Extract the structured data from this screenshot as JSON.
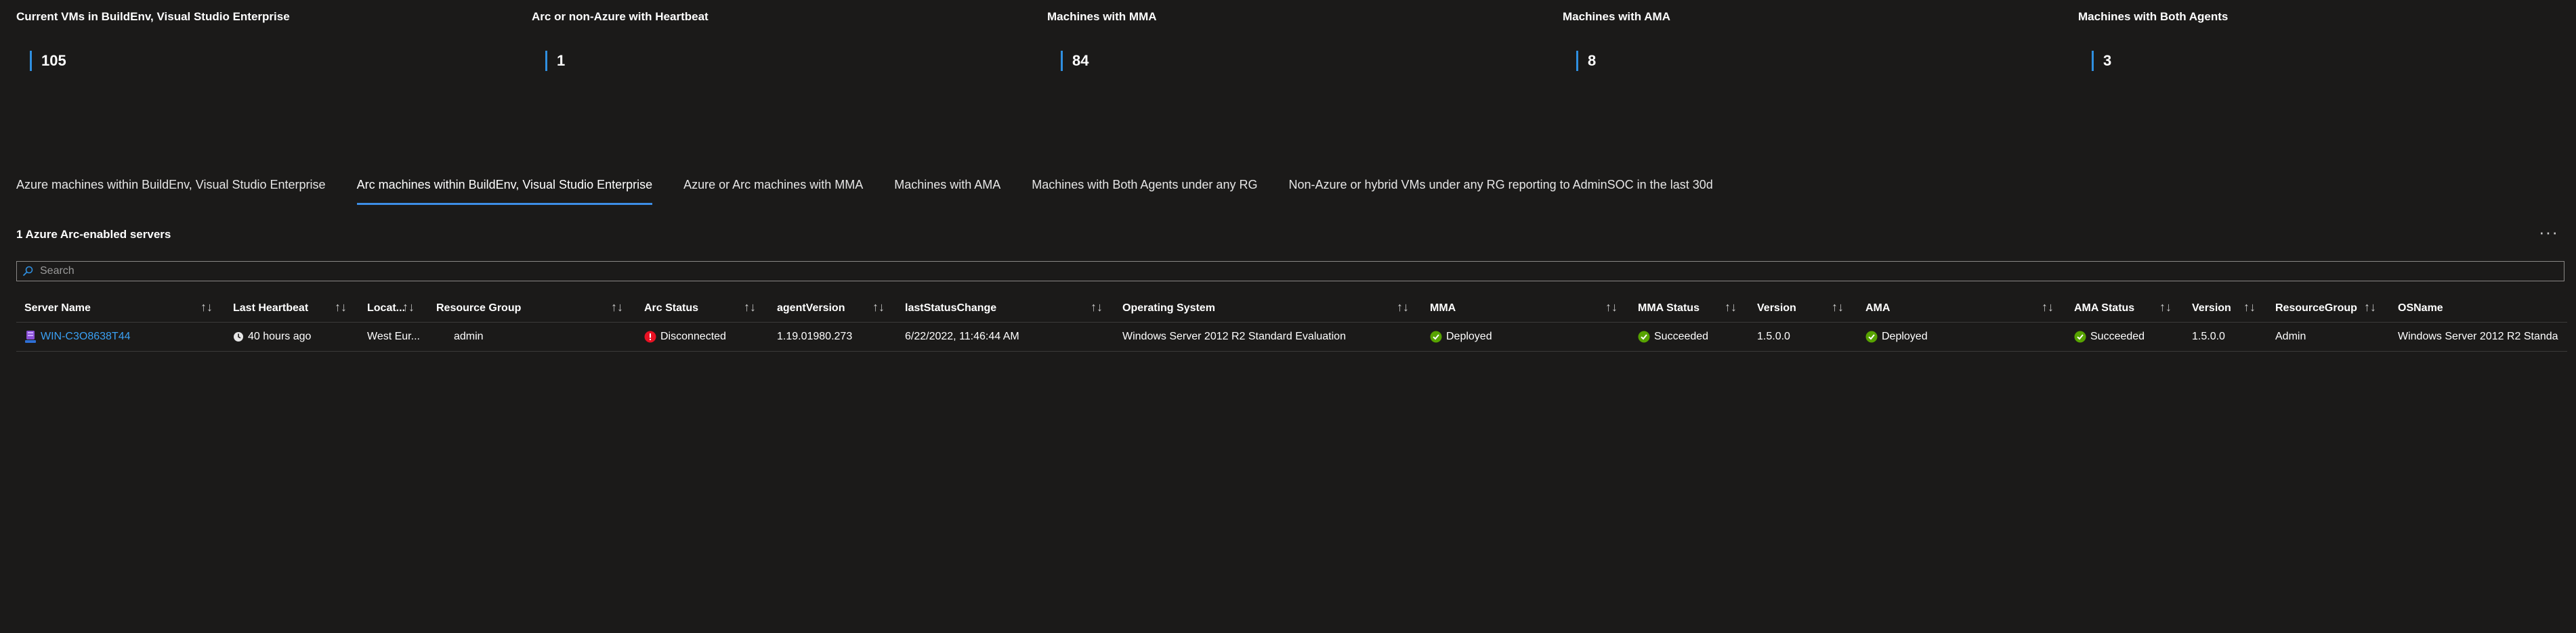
{
  "tiles": [
    {
      "title": "Current VMs in BuildEnv, Visual Studio Enterprise",
      "value": "105"
    },
    {
      "title": "Arc or non-Azure with Heartbeat",
      "value": "1"
    },
    {
      "title": "Machines with MMA",
      "value": "84"
    },
    {
      "title": "Machines with AMA",
      "value": "8"
    },
    {
      "title": "Machines with Both Agents",
      "value": "3"
    }
  ],
  "tabs": [
    {
      "label": "Azure machines within BuildEnv, Visual Studio Enterprise",
      "active": false
    },
    {
      "label": "Arc machines within BuildEnv, Visual Studio Enterprise",
      "active": true
    },
    {
      "label": "Azure or Arc machines with MMA",
      "active": false
    },
    {
      "label": "Machines with AMA",
      "active": false
    },
    {
      "label": "Machines with Both Agents under any RG",
      "active": false
    },
    {
      "label": "Non-Azure or hybrid VMs under any RG reporting to AdminSOC in the last 30d",
      "active": false
    }
  ],
  "grid": {
    "title": "1 Azure Arc-enabled servers",
    "more_icon": "ellipsis-icon",
    "search_placeholder": "Search",
    "columns": [
      "Server Name",
      "Last Heartbeat",
      "Locat...",
      "Resource Group",
      "Arc Status",
      "agentVersion",
      "lastStatusChange",
      "Operating System",
      "MMA",
      "MMA Status",
      "Version",
      "AMA",
      "AMA Status",
      "Version",
      "ResourceGroup",
      "OSName"
    ],
    "rows": [
      {
        "server_name": "WIN-C3O8638T44",
        "last_heartbeat": "40 hours ago",
        "location": "West Eur...",
        "resource_group": "admin",
        "arc_status": "Disconnected",
        "agent_version": "1.19.01980.273",
        "last_status_change": "6/22/2022, 11:46:44 AM",
        "operating_system": "Windows Server 2012 R2 Standard Evaluation",
        "mma": "Deployed",
        "mma_status": "Succeeded",
        "mma_version": "1.5.0.0",
        "ama": "Deployed",
        "ama_status": "Succeeded",
        "ama_version": "1.5.0.0",
        "resource_group2": "Admin",
        "os_name": "Windows Server 2012 R2 Standa"
      }
    ]
  },
  "colors": {
    "background": "#1b1a19",
    "accent": "#3d8ee6",
    "link": "#3aa0f3",
    "success": "#57a300",
    "error": "#e81123"
  }
}
